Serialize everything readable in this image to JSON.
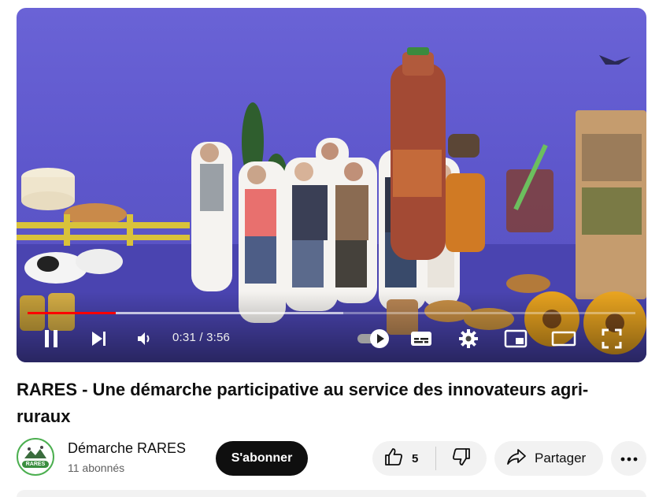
{
  "player": {
    "progress_fraction": 0.145,
    "buffer_fraction": 0.52,
    "time_current": "0:31",
    "time_separator": " / ",
    "time_total": "3:56",
    "accent_color": "#ff0000",
    "icons": {
      "pause": "pause-icon",
      "next": "next-icon",
      "volume": "volume-icon",
      "autoplay": "autoplay-toggle-icon",
      "subtitles": "subtitles-icon",
      "settings": "gear-icon",
      "miniplayer": "miniplayer-icon",
      "theater": "theater-mode-icon",
      "fullscreen": "fullscreen-icon"
    }
  },
  "video": {
    "title": "RARES - Une démarche participative au service des innovateurs agri-ruraux"
  },
  "channel": {
    "name": "Démarche RARES",
    "subscribers": "11 abonnés",
    "avatar_text": "RARES"
  },
  "actions": {
    "subscribe_label": "S'abonner",
    "like_count": "5",
    "share_label": "Partager"
  }
}
